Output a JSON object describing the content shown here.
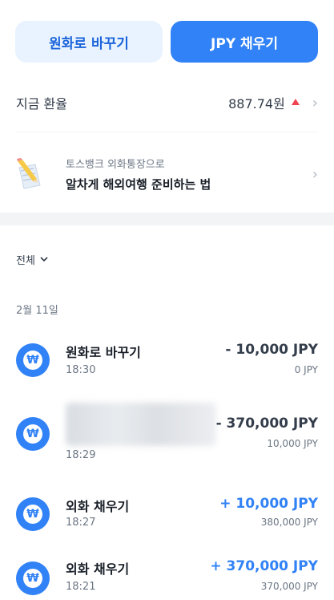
{
  "buttons": {
    "convert_label": "원화로 바꾸기",
    "charge_label": "JPY 채우기"
  },
  "rate": {
    "label": "지금 환율",
    "value": "887.74원",
    "trend": "up",
    "trend_color": "#f04452"
  },
  "promo": {
    "subtitle": "토스뱅크 외화통장으로",
    "title": "알차게 해외여행 준비하는 법",
    "icon": "notepad-pencil-icon"
  },
  "filter": {
    "label": "전체"
  },
  "date_group": "2월 11일",
  "colors": {
    "accent": "#3182f6",
    "accent_light": "#e8f3ff",
    "up": "#f04452"
  },
  "transactions": [
    {
      "title": "원화로 바꾸기",
      "time": "18:30",
      "amount": "- 10,000 JPY",
      "balance": "0 JPY",
      "type": "minus"
    },
    {
      "title": "",
      "time": "18:29",
      "amount": "- 370,000 JPY",
      "balance": "10,000 JPY",
      "type": "minus",
      "title_blurred": true
    },
    {
      "title": "외화 채우기",
      "time": "18:27",
      "amount": "+ 10,000 JPY",
      "balance": "380,000 JPY",
      "type": "plus"
    },
    {
      "title": "외화 채우기",
      "time": "18:21",
      "amount": "+ 370,000 JPY",
      "balance": "370,000 JPY",
      "type": "plus"
    }
  ],
  "tx_icon": "won-coin-icon"
}
